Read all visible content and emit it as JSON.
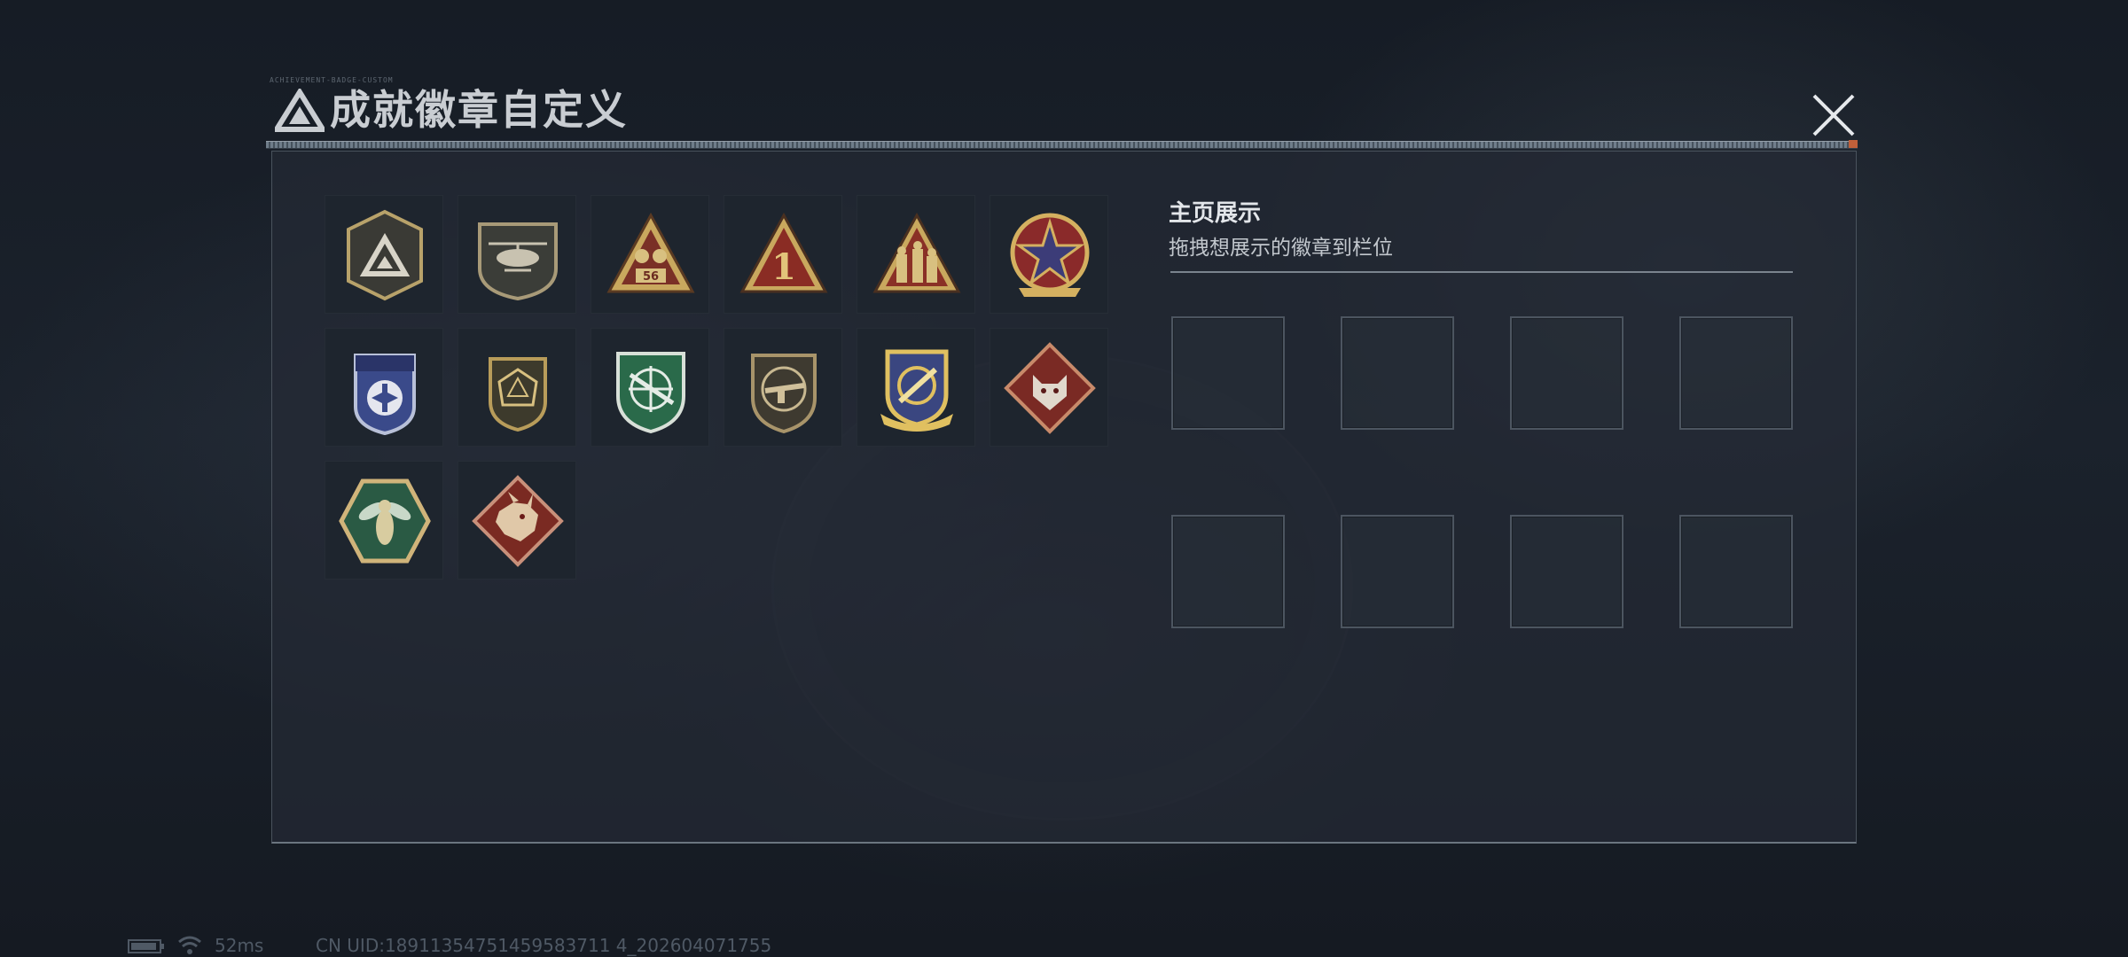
{
  "dialog": {
    "title": "成就徽章自定义",
    "header_tiny_text": "ACHIEVEMENT-BADGE-CUSTOM",
    "close_label": "×"
  },
  "badges": [
    {
      "name": "logo-triangle-badge"
    },
    {
      "name": "helicopter-badge"
    },
    {
      "name": "tank-56-badge",
      "label": "56"
    },
    {
      "name": "number-one-badge",
      "label": "1"
    },
    {
      "name": "soldiers-badge"
    },
    {
      "name": "star-compass-badge"
    },
    {
      "name": "blue-shield-badge"
    },
    {
      "name": "d20-dice-badge"
    },
    {
      "name": "green-crosshair-rifle-badge"
    },
    {
      "name": "bronze-rifle-badge"
    },
    {
      "name": "gold-missile-badge"
    },
    {
      "name": "wolf-diamond-badge"
    },
    {
      "name": "hornet-hexagon-badge"
    },
    {
      "name": "dragon-diamond-badge"
    }
  ],
  "showcase": {
    "title": "主页展示",
    "hint": "拖拽想展示的徽章到栏位",
    "slot_count": 8
  },
  "status": {
    "ping": "52ms",
    "uid": "CN UID:18911354751459583711 4_202604071755"
  }
}
